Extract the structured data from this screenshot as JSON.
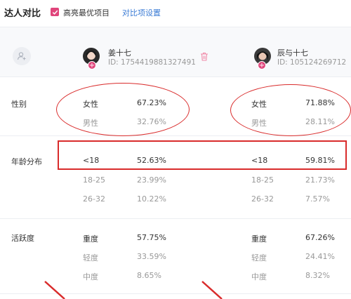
{
  "header": {
    "title": "达人对比",
    "highlight_label": "高亮最优项目",
    "highlight_checked": true,
    "settings_link": "对比项设置"
  },
  "influencers": [
    {
      "name": "姜十七",
      "id_text": "ID: 1754419881327491",
      "badge": "+"
    },
    {
      "name": "辰与十七",
      "id_text": "ID: 105124269712",
      "badge": "+"
    }
  ],
  "sections": {
    "gender": {
      "label": "性别",
      "rows": [
        {
          "label": "女性",
          "a": "67.23%",
          "b": "71.88%"
        },
        {
          "label": "男性",
          "a": "32.76%",
          "b": "28.11%"
        }
      ]
    },
    "age": {
      "label": "年龄分布",
      "rows": [
        {
          "label": "<18",
          "a": "52.63%",
          "b": "59.81%"
        },
        {
          "label": "18-25",
          "a": "23.99%",
          "b": "21.73%"
        },
        {
          "label": "26-32",
          "a": "10.22%",
          "b": "7.57%"
        }
      ]
    },
    "activity": {
      "label": "活跃度",
      "rows": [
        {
          "label": "重度",
          "a": "57.75%",
          "b": "67.26%"
        },
        {
          "label": "轻度",
          "a": "33.59%",
          "b": "24.41%"
        },
        {
          "label": "中度",
          "a": "8.65%",
          "b": "8.32%"
        }
      ]
    }
  },
  "colors": {
    "accent": "#e0457b",
    "link": "#3a7bd5",
    "annotation": "#d92b2b"
  },
  "icons": [
    "check-icon",
    "add-user-icon",
    "delete-icon",
    "plus-badge-icon"
  ]
}
